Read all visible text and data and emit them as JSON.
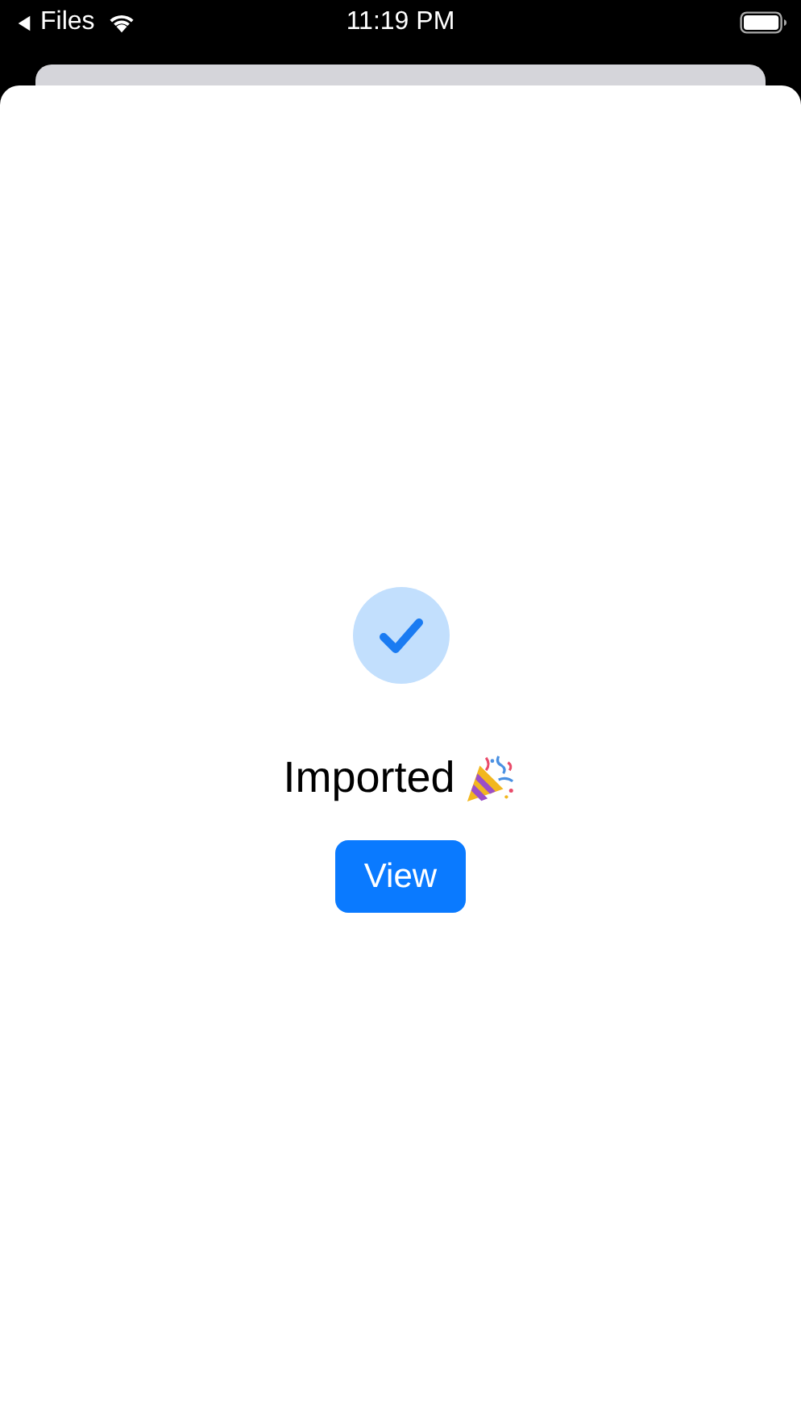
{
  "status_bar": {
    "back_label": "Files",
    "time": "11:19 PM"
  },
  "result": {
    "title": "Imported",
    "success": true
  },
  "buttons": [
    "View"
  ]
}
